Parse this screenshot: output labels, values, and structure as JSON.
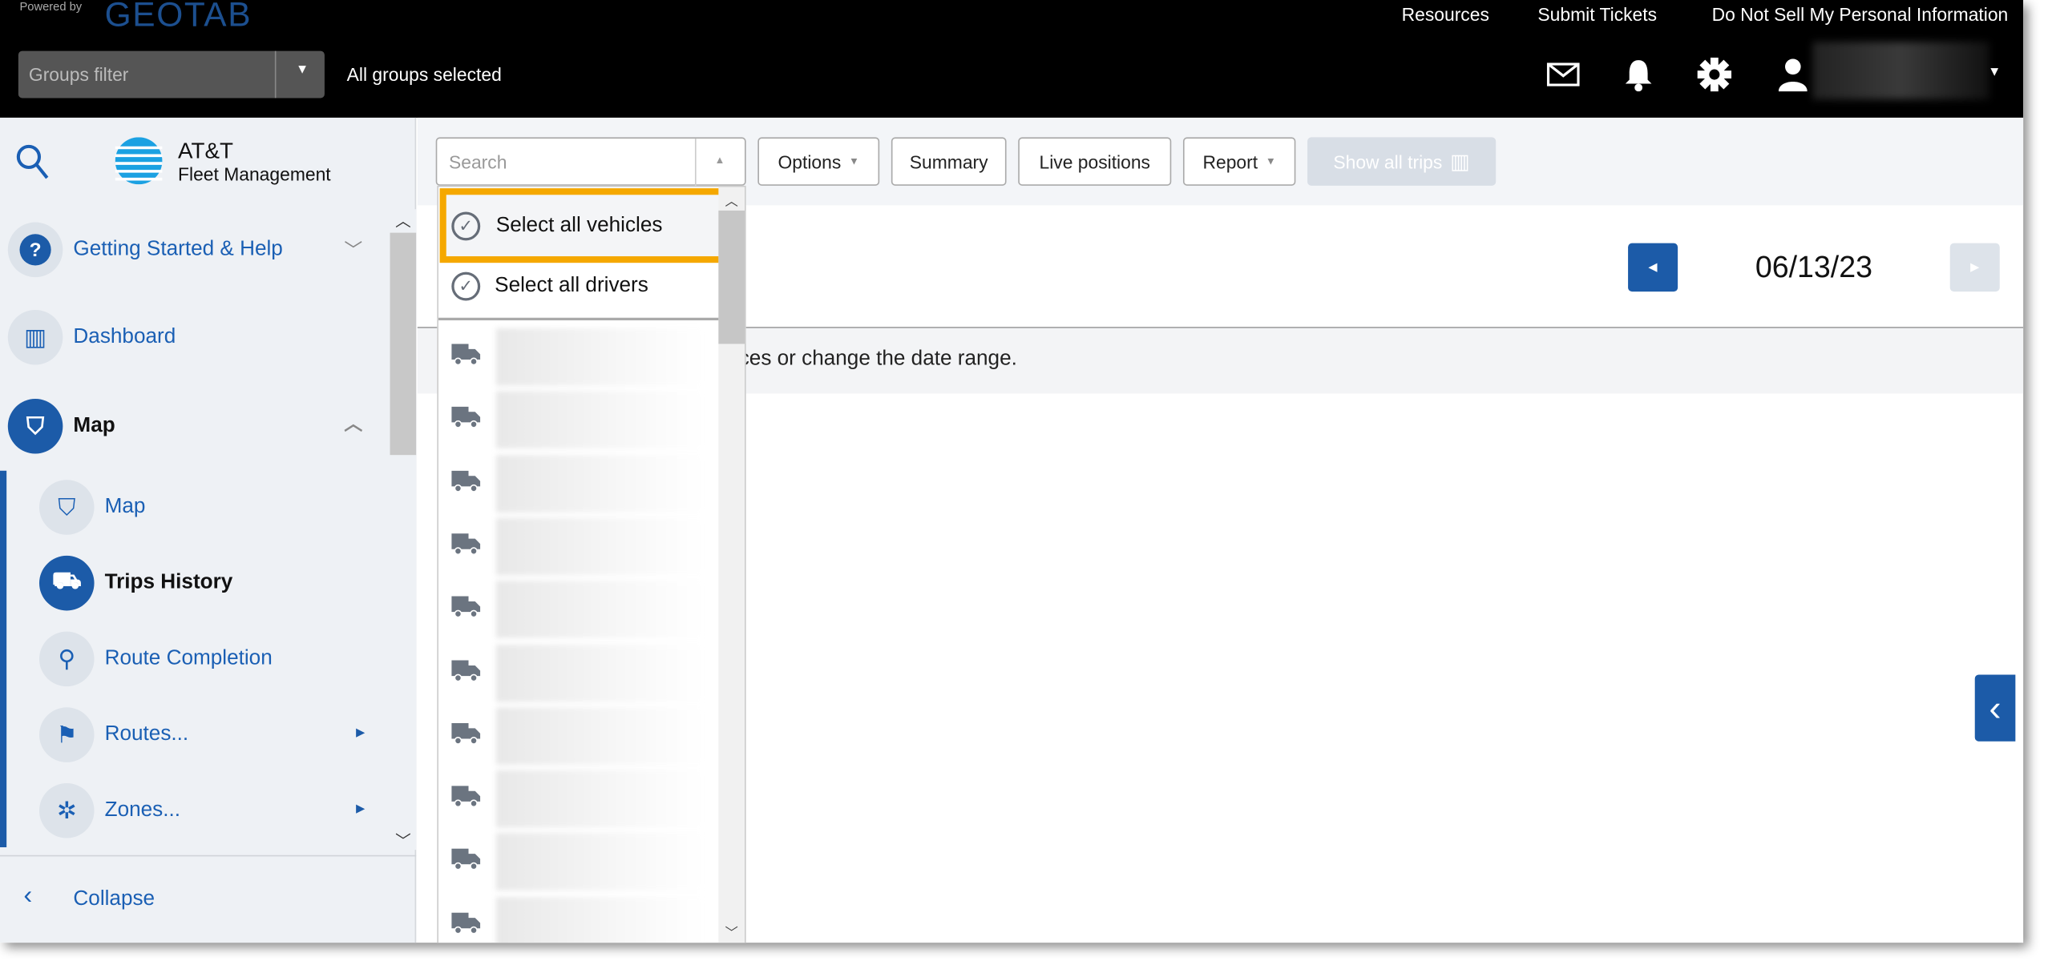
{
  "header": {
    "powered_by": "Powered by",
    "brand": "GEOTAB",
    "links": [
      "Resources",
      "Submit Tickets",
      "Do Not Sell My Personal Information"
    ],
    "groups_filter_placeholder": "Groups filter",
    "groups_status": "All groups selected",
    "icons": [
      "mail-icon",
      "bell-icon",
      "gear-icon",
      "user-icon"
    ]
  },
  "sidebar": {
    "logo_line1": "AT&T",
    "logo_line2": "Fleet Management",
    "items": [
      {
        "label": "Getting Started & Help"
      },
      {
        "label": "Dashboard"
      },
      {
        "label": "Map"
      }
    ],
    "sub_items": [
      {
        "label": "Map"
      },
      {
        "label": "Trips History"
      },
      {
        "label": "Route Completion"
      },
      {
        "label": "Routes..."
      },
      {
        "label": "Zones..."
      }
    ],
    "collapse": "Collapse"
  },
  "toolbar": {
    "search_placeholder": "Search",
    "options": "Options",
    "summary": "Summary",
    "live_positions": "Live positions",
    "report": "Report",
    "show_all_trips": "Show all trips"
  },
  "dropdown": {
    "select_all_vehicles": "Select all vehicles",
    "select_all_drivers": "Select all drivers",
    "highlight_color": "#f5a800"
  },
  "main": {
    "date": "06/13/23",
    "message": "ices or change the date range."
  },
  "colors": {
    "accent": "#1c5ba8",
    "topbar": "#000000"
  }
}
